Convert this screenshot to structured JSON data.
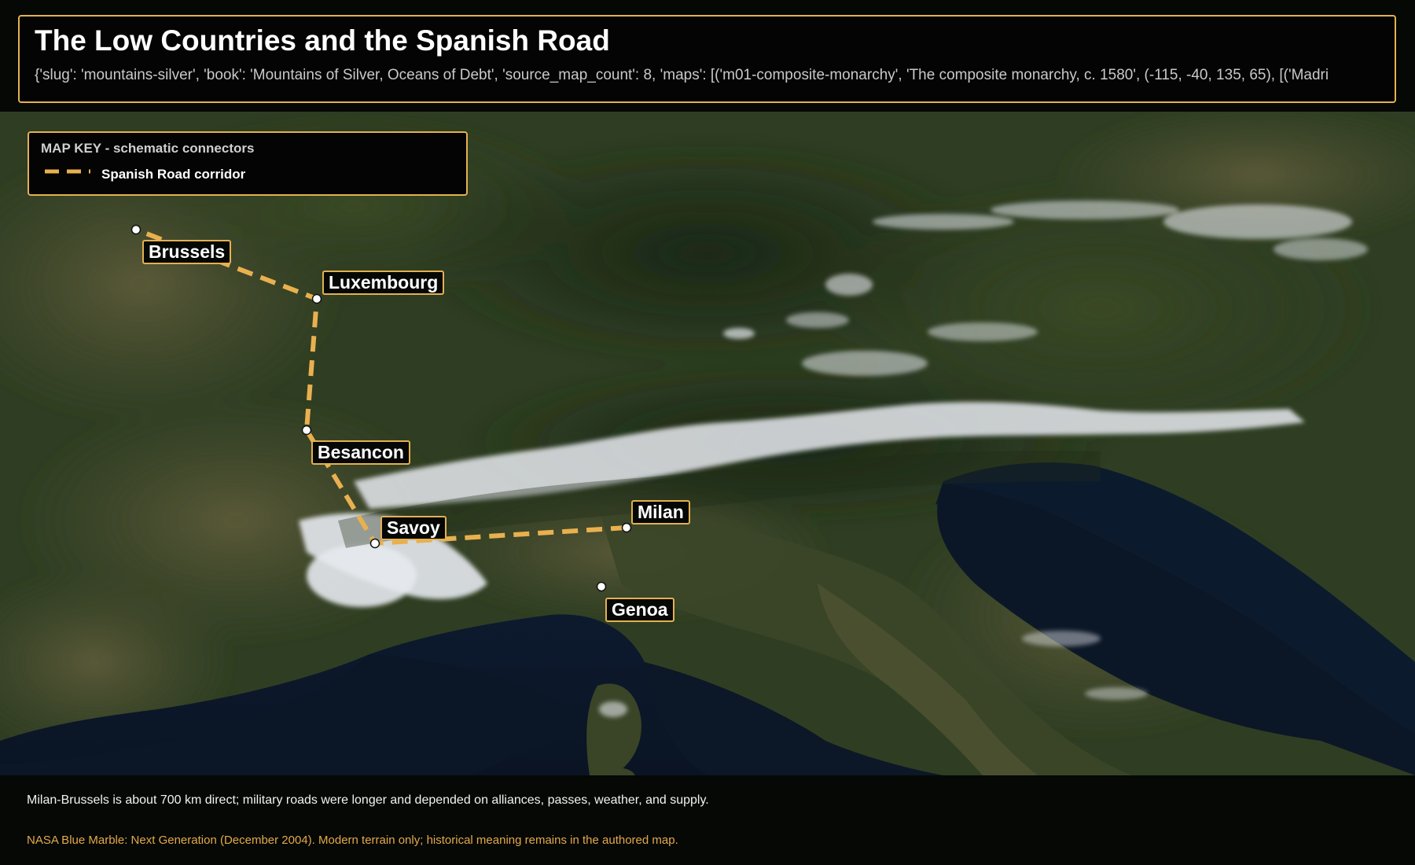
{
  "header": {
    "title": "The Low Countries and the Spanish Road",
    "subtitle": "{'slug': 'mountains-silver', 'book': 'Mountains of Silver, Oceans of Debt', 'source_map_count': 8, 'maps': [('m01-composite-monarchy', 'The composite monarchy, c. 1580', (-115, -40, 135, 65), [('Madri"
  },
  "map_key": {
    "title": "MAP KEY - schematic connectors",
    "items": [
      {
        "label": "Spanish Road corridor",
        "color": "#e9b04f",
        "style": "dashed"
      }
    ]
  },
  "route": {
    "name": "Spanish Road corridor",
    "color": "#e9b04f",
    "stops": [
      "Milan",
      "Savoy",
      "Besancon",
      "Luxembourg",
      "Brussels"
    ]
  },
  "places": [
    {
      "id": "brussels",
      "name": "Brussels"
    },
    {
      "id": "luxembourg",
      "name": "Luxembourg"
    },
    {
      "id": "besancon",
      "name": "Besancon"
    },
    {
      "id": "savoy",
      "name": "Savoy"
    },
    {
      "id": "milan",
      "name": "Milan"
    },
    {
      "id": "genoa",
      "name": "Genoa"
    }
  ],
  "footer": {
    "note": "Milan-Brussels is about 700 km direct; military roads were longer and depended on alliances, passes, weather, and supply.",
    "credit": "NASA Blue Marble: Next Generation (December 2004). Modern terrain only; historical meaning remains in the authored map."
  },
  "colors": {
    "accent": "#e4b052",
    "route": "#e9b04f",
    "credit": "#e4a94a",
    "background": "#050805"
  }
}
